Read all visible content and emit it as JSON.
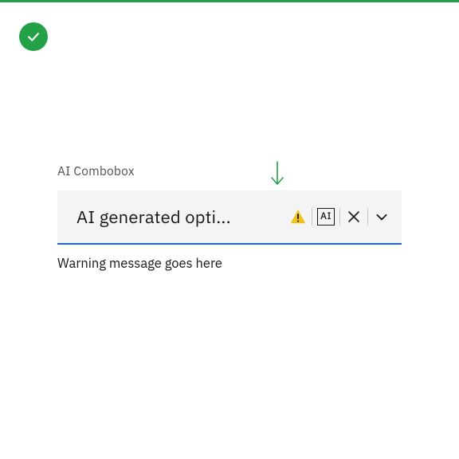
{
  "colors": {
    "accent": "#24a148",
    "focus": "#0f62fe",
    "warning": "#f1c21b"
  },
  "combobox": {
    "label": "AI Combobox",
    "value": "AI generated opti...",
    "ai_badge_text": "AI",
    "helper_text": "Warning message goes here"
  }
}
